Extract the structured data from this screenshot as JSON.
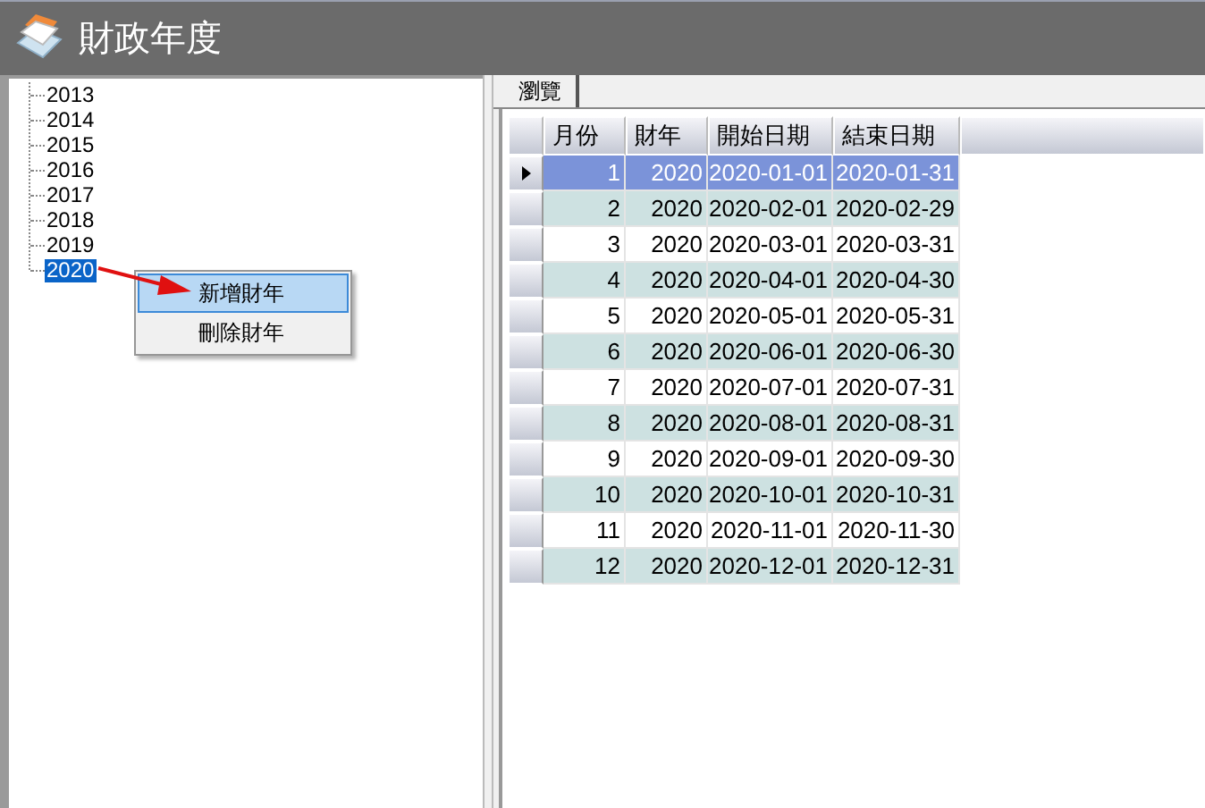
{
  "window": {
    "title": "財政年度"
  },
  "tree": {
    "items": [
      {
        "label": "2013",
        "selected": false
      },
      {
        "label": "2014",
        "selected": false
      },
      {
        "label": "2015",
        "selected": false
      },
      {
        "label": "2016",
        "selected": false
      },
      {
        "label": "2017",
        "selected": false
      },
      {
        "label": "2018",
        "selected": false
      },
      {
        "label": "2019",
        "selected": false
      },
      {
        "label": "2020",
        "selected": true
      }
    ]
  },
  "context_menu": {
    "items": [
      {
        "label": "新增財年",
        "selected": true
      },
      {
        "label": "刪除財年",
        "selected": false
      }
    ]
  },
  "tabs": [
    {
      "label": "瀏覽",
      "selected": true
    }
  ],
  "table": {
    "columns": [
      "月份",
      "財年",
      "開始日期",
      "結束日期"
    ],
    "rows": [
      {
        "cells": [
          "1",
          "2020",
          "2020-01-01",
          "2020-01-31"
        ],
        "selected": true
      },
      {
        "cells": [
          "2",
          "2020",
          "2020-02-01",
          "2020-02-29"
        ],
        "selected": false
      },
      {
        "cells": [
          "3",
          "2020",
          "2020-03-01",
          "2020-03-31"
        ],
        "selected": false
      },
      {
        "cells": [
          "4",
          "2020",
          "2020-04-01",
          "2020-04-30"
        ],
        "selected": false
      },
      {
        "cells": [
          "5",
          "2020",
          "2020-05-01",
          "2020-05-31"
        ],
        "selected": false
      },
      {
        "cells": [
          "6",
          "2020",
          "2020-06-01",
          "2020-06-30"
        ],
        "selected": false
      },
      {
        "cells": [
          "7",
          "2020",
          "2020-07-01",
          "2020-07-31"
        ],
        "selected": false
      },
      {
        "cells": [
          "8",
          "2020",
          "2020-08-01",
          "2020-08-31"
        ],
        "selected": false
      },
      {
        "cells": [
          "9",
          "2020",
          "2020-09-01",
          "2020-09-30"
        ],
        "selected": false
      },
      {
        "cells": [
          "10",
          "2020",
          "2020-10-01",
          "2020-10-31"
        ],
        "selected": false
      },
      {
        "cells": [
          "11",
          "2020",
          "2020-11-01",
          "2020-11-30"
        ],
        "selected": false
      },
      {
        "cells": [
          "12",
          "2020",
          "2020-12-01",
          "2020-12-31"
        ],
        "selected": false
      }
    ]
  }
}
